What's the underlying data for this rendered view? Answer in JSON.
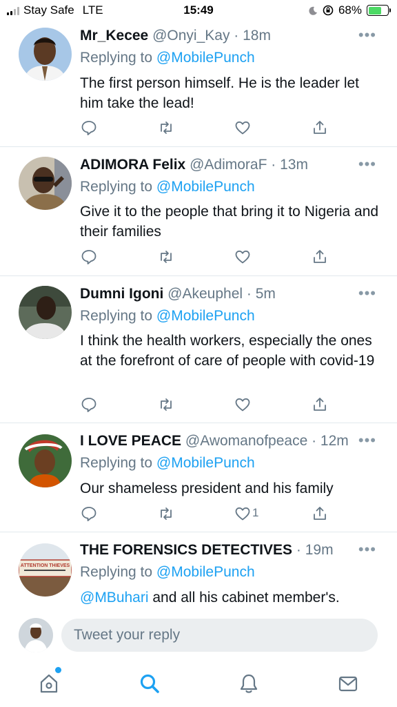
{
  "status_bar": {
    "carrier": "Stay Safe",
    "network": "LTE",
    "time": "15:49",
    "battery_percent": "68%",
    "battery_level": 0.68
  },
  "tweets": [
    {
      "name": "Mr_Kecee",
      "handle": "@Onyi_Kay",
      "time": "18m",
      "replying_prefix": "Replying to",
      "replying_to": "@MobilePunch",
      "text": "The first person himself. He is the leader let him take the lead!",
      "likes": ""
    },
    {
      "name": "ADIMORA Felix",
      "handle": "@AdimoraF",
      "time": "13m",
      "replying_prefix": "Replying to",
      "replying_to": "@MobilePunch",
      "text": "Give it to the people that bring it to Nigeria and their families",
      "likes": ""
    },
    {
      "name": "Dumni Igoni",
      "handle": "@Akeuphel",
      "time": "5m",
      "replying_prefix": "Replying to",
      "replying_to": "@MobilePunch",
      "text": "I think the health workers, especially the ones at the forefront of care of people with covid-19",
      "likes": ""
    },
    {
      "name": "I LOVE PEACE",
      "handle": "@Awomanofpeace",
      "time": "12m",
      "replying_prefix": "Replying to",
      "replying_to": "@MobilePunch",
      "text": "Our shameless president and his family",
      "likes": "1"
    },
    {
      "name": "THE FORENSICS DETECTIVES",
      "handle": "",
      "time": "19m",
      "replying_prefix": "Replying to",
      "replying_to": "@MobilePunch",
      "text_mention": "@MBuhari",
      "text": " and all his cabinet member's.",
      "avatar_text": "ATTENTION THIEVES"
    }
  ],
  "composer": {
    "placeholder": "Tweet your reply"
  },
  "bottom_nav": [
    {
      "icon": "home-icon"
    },
    {
      "icon": "search-icon"
    },
    {
      "icon": "notifications-icon"
    },
    {
      "icon": "messages-icon"
    }
  ],
  "colors": {
    "accent": "#1da1f2",
    "muted": "#657786",
    "icon_gray": "#657786"
  }
}
